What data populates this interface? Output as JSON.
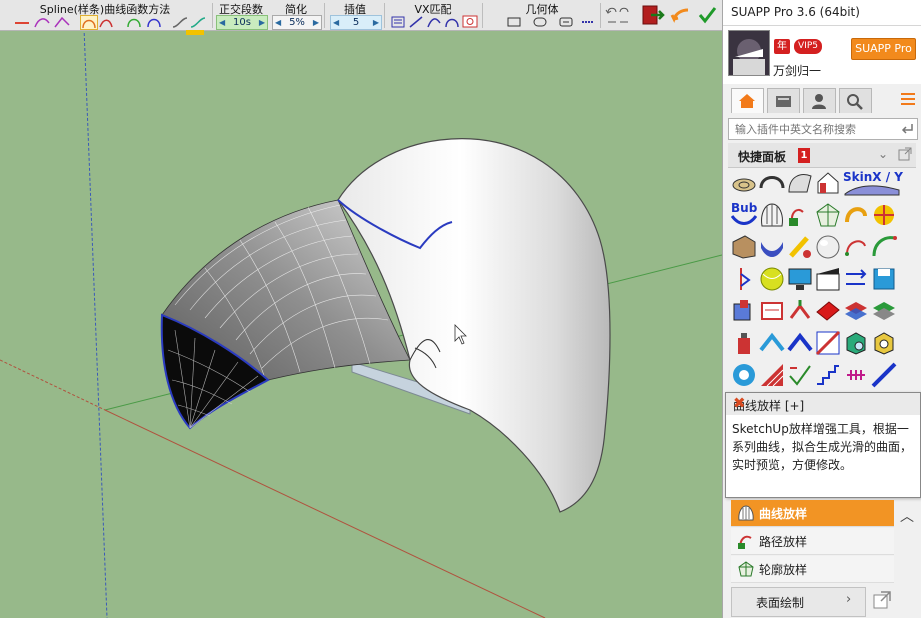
{
  "toolbar": {
    "spline_group": "Spline(样条)曲线函数方法",
    "segments_group": "正交段数",
    "segments_value": "10s",
    "simplify_group": "简化",
    "simplify_value": "5%",
    "interp_group": "插值",
    "interp_value": "5",
    "vx_group": "VX匹配",
    "geometry_group": "几何体"
  },
  "panel": {
    "title": "SUAPP Pro 3.6 (64bit)",
    "user": {
      "year_badge": "年",
      "vip_badge": "VIP5",
      "username": "万剑归一",
      "suapp_button": "SUAPP Pro"
    },
    "tabs": [
      "home-icon",
      "toolbox-icon",
      "user-icon",
      "search-icon"
    ],
    "search_placeholder": "输入插件中英文名称搜索",
    "quick_panel": {
      "label": "快捷面板",
      "badge": "1"
    },
    "grid_labels": {
      "skin": "SkinX / Y",
      "bub": "Bub"
    }
  },
  "tooltip": {
    "title": "曲线放样 [+]",
    "description": "SketchUp放样增强工具，根据一系列曲线，拟合生成光滑的曲面，实时预览，方便修改。"
  },
  "tool_list": [
    {
      "label": "曲线放样",
      "icon": "loft-icon",
      "selected": true
    },
    {
      "label": "路径放样",
      "icon": "path-loft-icon",
      "selected": false
    },
    {
      "label": "轮廓放样",
      "icon": "profile-loft-icon",
      "selected": false
    }
  ],
  "surface_menu": {
    "label": "表面绘制"
  },
  "colors": {
    "viewport": "#97b98a",
    "accent": "#f29424",
    "panel": "#f0f0f0"
  }
}
